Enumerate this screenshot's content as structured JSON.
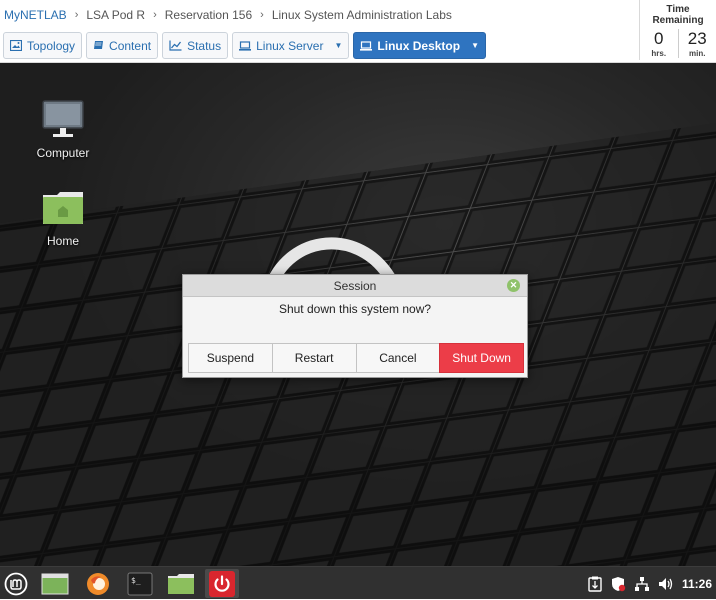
{
  "breadcrumb": {
    "items": [
      "MyNETLAB",
      "LSA Pod R",
      "Reservation 156",
      "Linux System Administration Labs"
    ],
    "separator": "›"
  },
  "nav": {
    "topology": "Topology",
    "content": "Content",
    "status": "Status",
    "linux_server": "Linux Server",
    "linux_desktop": "Linux Desktop"
  },
  "timer": {
    "title": "Time Remaining",
    "hours": "0",
    "hours_unit": "hrs.",
    "minutes": "23",
    "minutes_unit": "min."
  },
  "desktop": {
    "icons": [
      {
        "label": "Computer",
        "icon": "monitor-icon"
      },
      {
        "label": "Home",
        "icon": "folder-home-icon"
      }
    ]
  },
  "dialog": {
    "title": "Session",
    "message": "Shut down this system now?",
    "buttons": {
      "suspend": "Suspend",
      "restart": "Restart",
      "cancel": "Cancel",
      "shutdown": "Shut Down"
    }
  },
  "taskbar": {
    "clock": "11:26",
    "launchers": [
      "mint-menu-icon",
      "show-desktop-icon",
      "firefox-icon",
      "terminal-icon",
      "files-icon",
      "power-icon"
    ],
    "terminal_prompt": "$_"
  },
  "colors": {
    "accent": "#2f74c0",
    "danger": "#ec3d48",
    "folder_green": "#8cbf5d",
    "taskbar": "#303030"
  }
}
